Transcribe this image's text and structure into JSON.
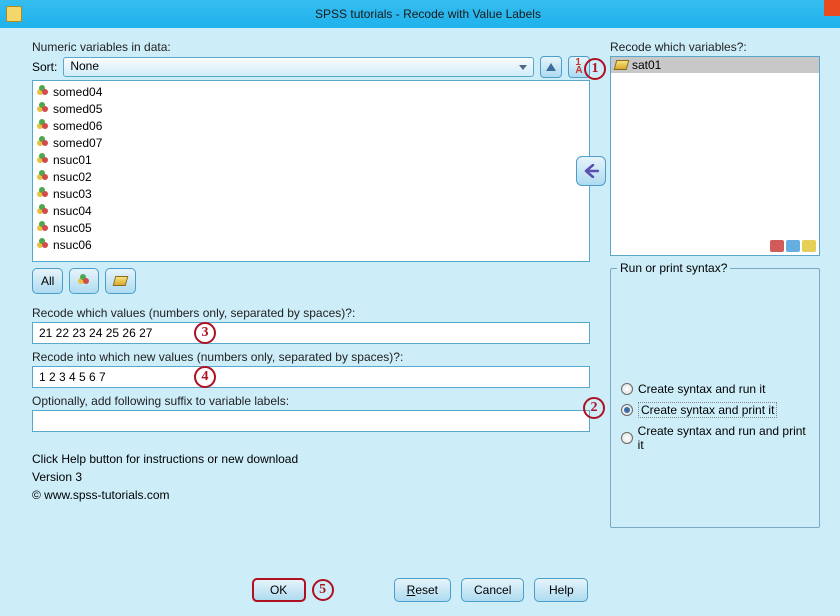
{
  "window": {
    "title": "SPSS tutorials - Recode with Value Labels"
  },
  "left": {
    "numeric_vars_label": "Numeric variables in data:",
    "sort_label": "Sort:",
    "sort_value": "None",
    "vars": [
      "somed04",
      "somed05",
      "somed06",
      "somed07",
      "nsuc01",
      "nsuc02",
      "nsuc03",
      "nsuc04",
      "nsuc05",
      "nsuc06"
    ],
    "filter_all": "All",
    "recode_values_label": "Recode which values (numbers only, separated by spaces)?:",
    "recode_values_input": "21 22 23 24 25 26 27",
    "recode_into_label": "Recode into which new values (numbers only, separated by spaces)?:",
    "recode_into_input": "1 2 3 4 5 6 7",
    "suffix_label": "Optionally, add following suffix to variable labels:",
    "suffix_input": "",
    "info_line1": "Click Help button for instructions or new download",
    "info_line2": "Version 3",
    "info_line3": "© www.spss-tutorials.com"
  },
  "right": {
    "target_label": "Recode which variables?:",
    "selected_var": "sat01",
    "fieldset_legend": "Run or print syntax?",
    "radios": [
      {
        "label": "Create syntax and run it",
        "checked": false
      },
      {
        "label": "Create syntax and print it",
        "checked": true
      },
      {
        "label": "Create syntax and run and print it",
        "checked": false
      }
    ]
  },
  "buttons": {
    "ok": "OK",
    "reset": "Reset",
    "cancel": "Cancel",
    "help": "Help"
  },
  "callouts": {
    "c1": "1",
    "c2": "2",
    "c3": "3",
    "c4": "4",
    "c5": "5"
  }
}
